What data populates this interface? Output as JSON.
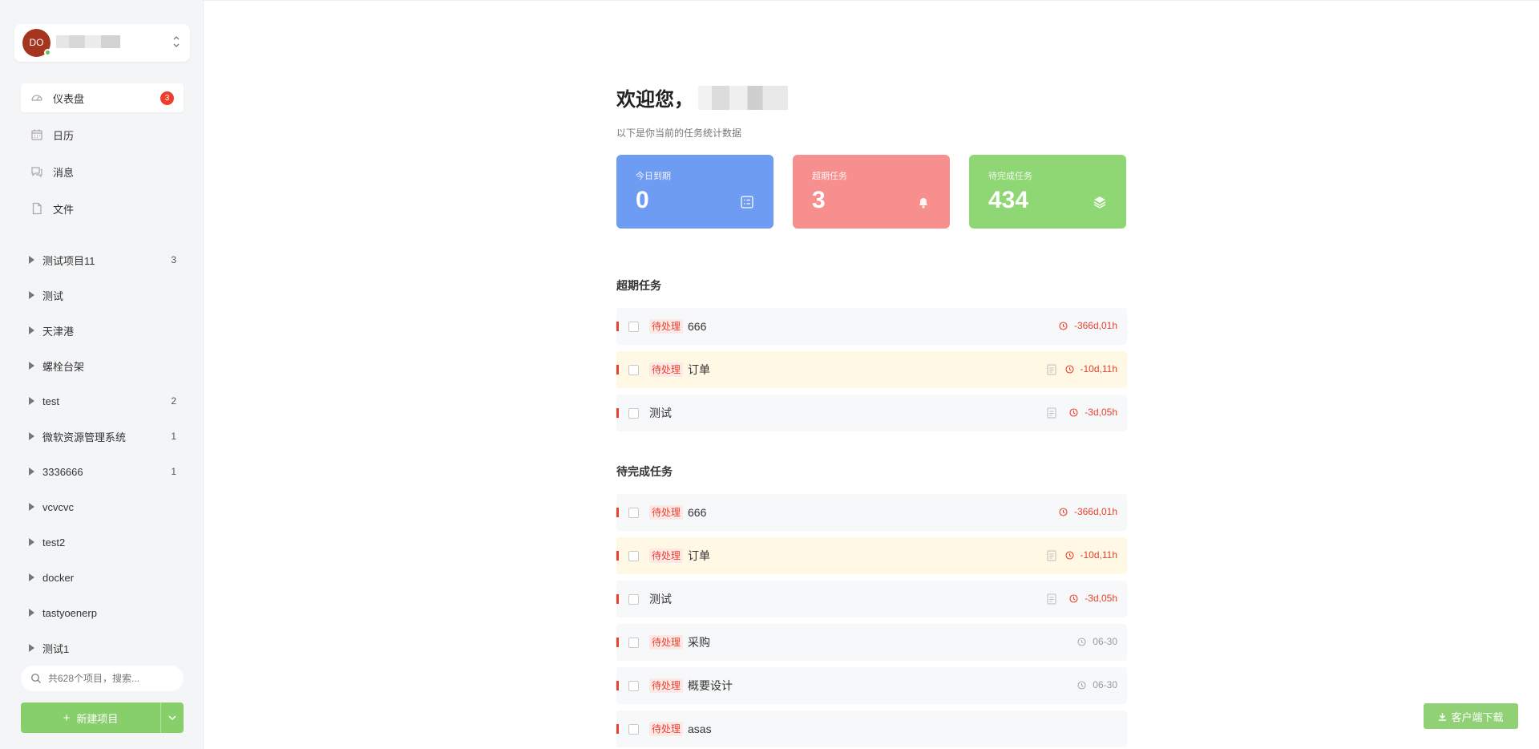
{
  "user": {
    "avatar_initials": "DO",
    "online": true
  },
  "nav": [
    {
      "label": "仪表盘",
      "icon": "dashboard-icon",
      "badge": "3",
      "active": true
    },
    {
      "label": "日历",
      "icon": "calendar-icon"
    },
    {
      "label": "消息",
      "icon": "message-icon"
    },
    {
      "label": "文件",
      "icon": "file-icon"
    }
  ],
  "projects": [
    {
      "name": "测试项目11",
      "count": "3"
    },
    {
      "name": "测试",
      "count": ""
    },
    {
      "name": "天津港",
      "count": ""
    },
    {
      "name": "螺栓台架",
      "count": ""
    },
    {
      "name": "test",
      "count": "2"
    },
    {
      "name": "微软资源管理系统",
      "count": "1"
    },
    {
      "name": "3336666",
      "count": "1"
    },
    {
      "name": "vcvcvc",
      "count": ""
    },
    {
      "name": "test2",
      "count": ""
    },
    {
      "name": "docker",
      "count": ""
    },
    {
      "name": "tastyoenerp",
      "count": ""
    },
    {
      "name": "测试1",
      "count": ""
    }
  ],
  "search": {
    "placeholder": "共628个项目，搜索..."
  },
  "new_project": {
    "label": "新建项目"
  },
  "welcome": {
    "title": "欢迎您，",
    "subtitle": "以下是你当前的任务统计数据"
  },
  "cards": [
    {
      "title": "今日到期",
      "value": "0",
      "color": "#6f9cf3",
      "icon": "checklist-icon"
    },
    {
      "title": "超期任务",
      "value": "3",
      "color": "#f78f8f",
      "icon": "bell-icon"
    },
    {
      "title": "待完成任务",
      "value": "434",
      "color": "#8fd674",
      "icon": "layers-icon"
    }
  ],
  "sections": {
    "overdue": {
      "title": "超期任务",
      "tasks": [
        {
          "tag": "待处理",
          "name": "666",
          "time": "-366d,01h",
          "time_status": "overdue",
          "has_doc": false,
          "highlight": false
        },
        {
          "tag": "待处理",
          "name": "订单",
          "time": "-10d,11h",
          "time_status": "overdue",
          "has_doc": true,
          "highlight": true
        },
        {
          "tag": "",
          "name": "测试",
          "time": "-3d,05h",
          "time_status": "overdue",
          "has_doc": true,
          "highlight": false
        }
      ]
    },
    "pending": {
      "title": "待完成任务",
      "tasks": [
        {
          "tag": "待处理",
          "name": "666",
          "time": "-366d,01h",
          "time_status": "overdue",
          "has_doc": false,
          "highlight": false
        },
        {
          "tag": "待处理",
          "name": "订单",
          "time": "-10d,11h",
          "time_status": "overdue",
          "has_doc": true,
          "highlight": true
        },
        {
          "tag": "",
          "name": "测试",
          "time": "-3d,05h",
          "time_status": "overdue",
          "has_doc": true,
          "highlight": false
        },
        {
          "tag": "待处理",
          "name": "采购",
          "time": "06-30",
          "time_status": "normal",
          "has_doc": false,
          "highlight": false
        },
        {
          "tag": "待处理",
          "name": "概要设计",
          "time": "06-30",
          "time_status": "normal",
          "has_doc": false,
          "highlight": false
        },
        {
          "tag": "待处理",
          "name": "asas",
          "time": "",
          "time_status": "normal",
          "has_doc": false,
          "highlight": false
        }
      ]
    }
  },
  "download": {
    "label": "客户端下载"
  },
  "colors": {
    "accent_green": "#86cf6a",
    "danger": "#e8412e",
    "badge": "#ee3f2e"
  }
}
